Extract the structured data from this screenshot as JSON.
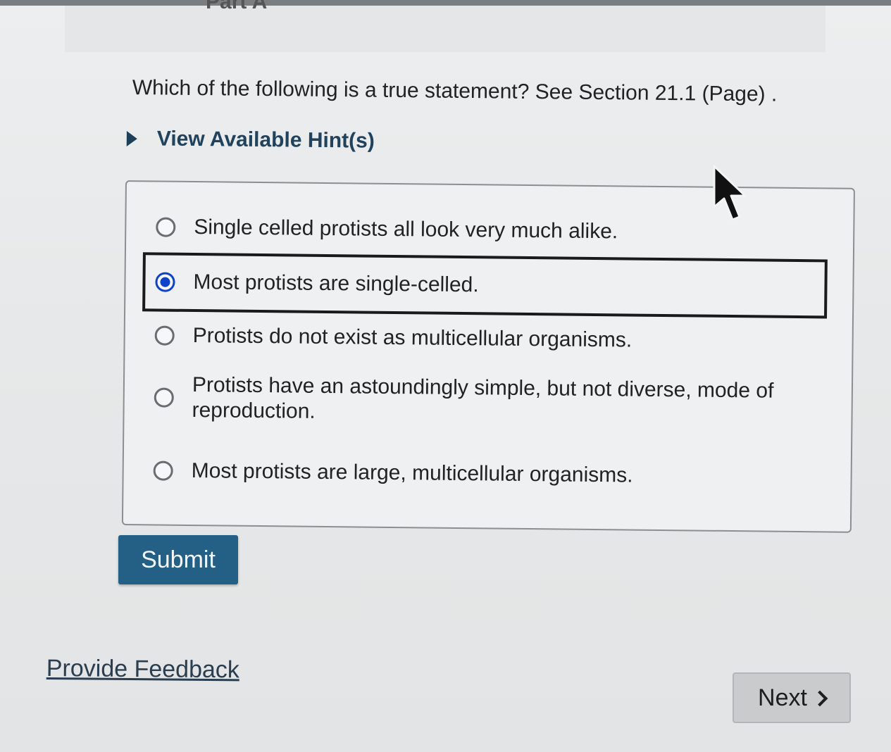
{
  "header": {
    "part_title": "Part A"
  },
  "question": {
    "text": "Which of the following is a true statement? See Section 21.1 (Page) ."
  },
  "hint": {
    "label": "View Available Hint(s)",
    "icon": "triangle-right-icon"
  },
  "options": [
    {
      "label": "Single celled protists all look very much alike.",
      "checked": false
    },
    {
      "label": "Most protists are single-celled.",
      "checked": true
    },
    {
      "label": "Protists do not exist as multicellular organisms.",
      "checked": false
    },
    {
      "label": "Protists have an astoundingly simple, but not diverse, mode of reproduction.",
      "checked": false
    },
    {
      "label": "Most protists are large, multicellular organisms.",
      "checked": false
    }
  ],
  "actions": {
    "submit_label": "Submit",
    "feedback_label": "Provide Feedback",
    "next_label": "Next"
  },
  "colors": {
    "submit_bg": "#245f86",
    "link": "#21425d",
    "radio_checked": "#0e43c9"
  },
  "icons": {
    "cursor": "mouse-pointer-icon",
    "next": "chevron-right-icon"
  }
}
